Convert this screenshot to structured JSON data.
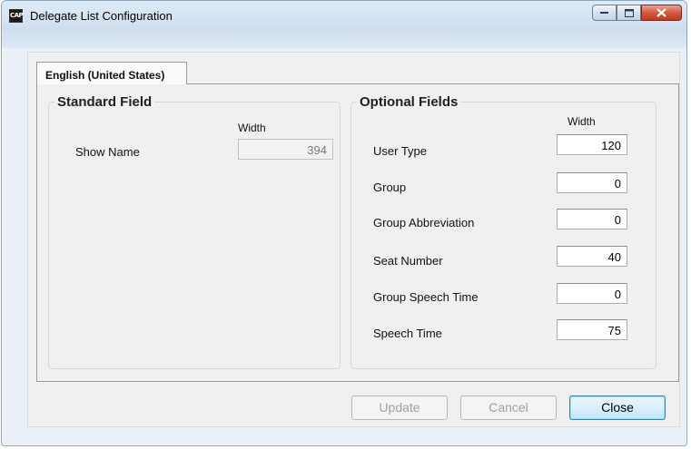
{
  "window": {
    "title": "Delegate List Configuration",
    "app_icon_text": "CAP",
    "controls": [
      "minimize-icon",
      "maximize-icon",
      "close-icon"
    ]
  },
  "tabs": [
    {
      "label": "English (United States)",
      "selected": true
    }
  ],
  "standard": {
    "title": "Standard Field",
    "width_header": "Width",
    "items": [
      {
        "label": "Show Name",
        "width": "394",
        "enabled": false
      }
    ]
  },
  "optional": {
    "title": "Optional Fields",
    "width_header": "Width",
    "items": [
      {
        "label": "User Type",
        "width": "120"
      },
      {
        "label": "Group",
        "width": "0"
      },
      {
        "label": "Group Abbreviation",
        "width": "0"
      },
      {
        "label": "Seat Number",
        "width": "40"
      },
      {
        "label": "Group Speech Time",
        "width": "0"
      },
      {
        "label": "Speech Time",
        "width": "75"
      }
    ]
  },
  "buttons": {
    "update": {
      "label": "Update",
      "enabled": false
    },
    "cancel": {
      "label": "Cancel",
      "enabled": false
    },
    "close": {
      "label": "Close",
      "enabled": true
    }
  },
  "colors": {
    "accent": "#3c7fb1",
    "close_button": "#c23a1f"
  }
}
